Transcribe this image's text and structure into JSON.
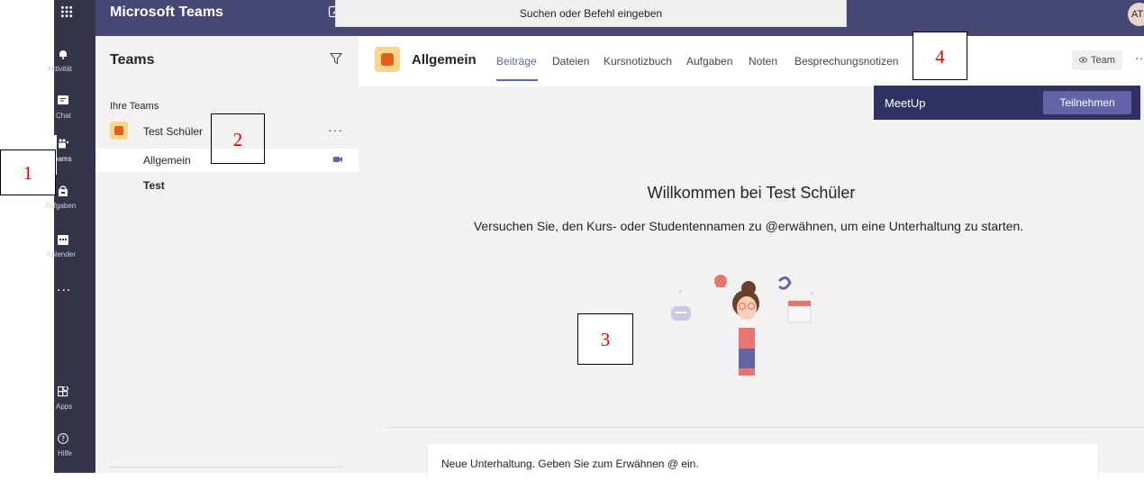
{
  "app": {
    "title": "Microsoft Teams",
    "search_placeholder": "Suchen oder Befehl eingeben",
    "avatar_initials": "AT",
    "brand_color": "#464775",
    "accent_color": "#6264a7"
  },
  "rail": {
    "items": [
      {
        "label": "Aktivität",
        "icon": "bell-icon"
      },
      {
        "label": "Chat",
        "icon": "chat-icon"
      },
      {
        "label": "Teams",
        "icon": "teams-icon",
        "active": true
      },
      {
        "label": "Aufgaben",
        "icon": "assignments-icon"
      },
      {
        "label": "Kalender",
        "icon": "calendar-icon"
      },
      {
        "label": "...",
        "icon": "more-icon"
      },
      {
        "label": "Apps",
        "icon": "apps-icon"
      },
      {
        "label": "Hilfe",
        "icon": "help-icon"
      }
    ]
  },
  "panel": {
    "title": "Teams",
    "section_label": "Ihre Teams",
    "team_name": "Test Schüler",
    "team_more": "···",
    "channels": [
      {
        "label": "Allgemein",
        "selected": true
      },
      {
        "label": "Test",
        "bold": true
      }
    ]
  },
  "channel_header": {
    "title": "Allgemein",
    "tabs": [
      "Beiträge",
      "Dateien",
      "Kursnotizbuch",
      "Aufgaben",
      "Noten",
      "Besprechungsnotizen"
    ],
    "active_tab": "Beiträge",
    "team_button": "Team",
    "more": "···"
  },
  "meetup": {
    "label": "MeetUp",
    "join_label": "Teilnehmen"
  },
  "welcome": {
    "title": "Willkommen bei Test Schüler",
    "subtitle": "Versuchen Sie, den Kurs- oder Studentennamen zu @erwähnen, um eine Unterhaltung zu starten."
  },
  "compose": {
    "placeholder": "Neue Unterhaltung. Geben Sie zum Erwähnen @ ein."
  },
  "annotations": [
    "1",
    "2",
    "3",
    "4"
  ]
}
